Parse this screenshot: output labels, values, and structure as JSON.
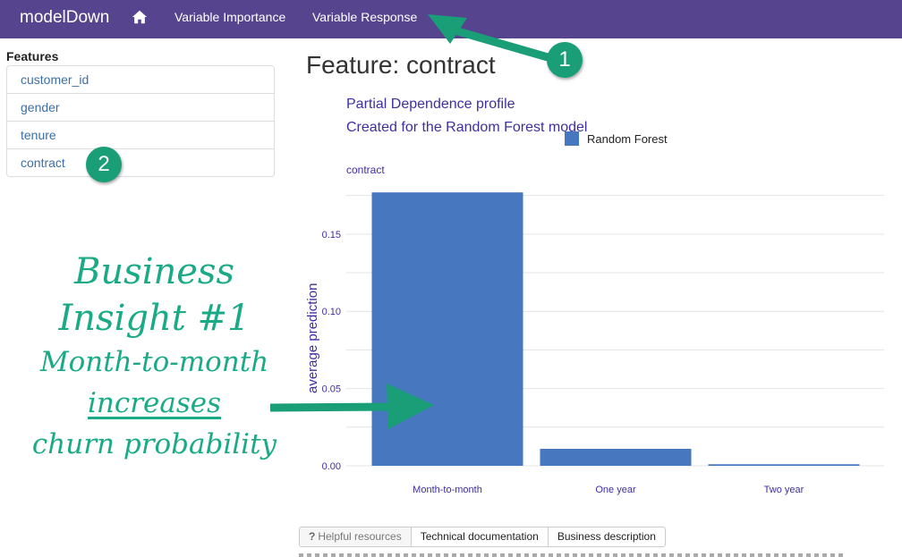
{
  "navbar": {
    "brand": "modelDown",
    "home_icon": "home-icon",
    "links": [
      "Variable Importance",
      "Variable Response"
    ],
    "bg_color": "#56448f"
  },
  "sidebar": {
    "heading": "Features",
    "items": [
      "customer_id",
      "gender",
      "tenure",
      "contract"
    ]
  },
  "main": {
    "title": "Feature: contract"
  },
  "chart_data": {
    "type": "bar",
    "title": "Partial Dependence profile",
    "subtitle": "Created for the Random Forest model",
    "panel_label": "contract",
    "categories": [
      "Month-to-month",
      "One year",
      "Two year"
    ],
    "series": [
      {
        "name": "Random Forest",
        "values": [
          0.177,
          0.011,
          0.001
        ],
        "color": "#4677bf"
      }
    ],
    "ylabel": "average prediction",
    "xlabel": "",
    "yticks": [
      "0.00",
      "0.05",
      "0.10",
      "0.15"
    ],
    "ylim": [
      0,
      0.18
    ],
    "grid": true,
    "legend": "top"
  },
  "tabs": {
    "items": [
      "Helpful resources",
      "Technical documentation",
      "Business description"
    ],
    "help_glyph": "?"
  },
  "annotation": {
    "lines": [
      "Business",
      "Insight #1",
      "Month-to-month",
      "increases",
      "churn probability"
    ],
    "badges": [
      "1",
      "2"
    ],
    "color": "#1aaa86"
  }
}
